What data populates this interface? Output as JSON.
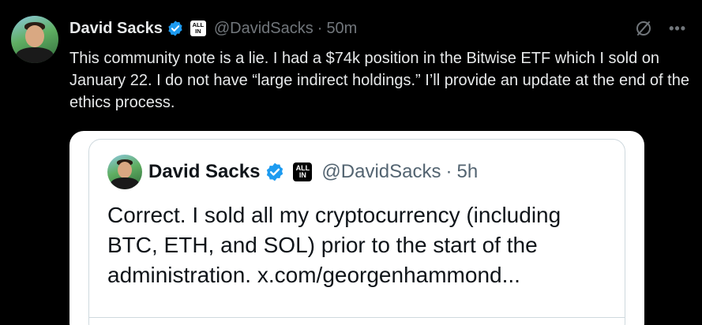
{
  "tweet": {
    "author_name": "David Sacks",
    "affiliate_badge": "ALL IN",
    "affiliate_line1": "ALL",
    "affiliate_line2": "IN",
    "handle": "@DavidSacks",
    "separator": "·",
    "time": "50m",
    "more_label": "•••",
    "text": "This community note is a lie. I had a $74k position in the Bitwise ETF which I sold on January 22. I do not have “large indirect holdings.” I’ll provide an update at the end of the ethics process."
  },
  "quote": {
    "author_name": "David Sacks",
    "affiliate_line1": "ALL",
    "affiliate_line2": "IN",
    "handle": "@DavidSacks",
    "separator": "·",
    "time": "5h",
    "text": "Correct. I sold all my cryptocurrency (including BTC, ETH, and SOL) prior to the start of the administration. x.com/georgenhammond..."
  },
  "icons": {
    "verified": "verified-badge-icon",
    "grok": "grok-icon",
    "more": "more-icon"
  },
  "colors": {
    "verified_blue": "#1d9bf0",
    "background": "#000000",
    "muted_text": "#71767b",
    "quote_card_bg": "#ffffff"
  }
}
